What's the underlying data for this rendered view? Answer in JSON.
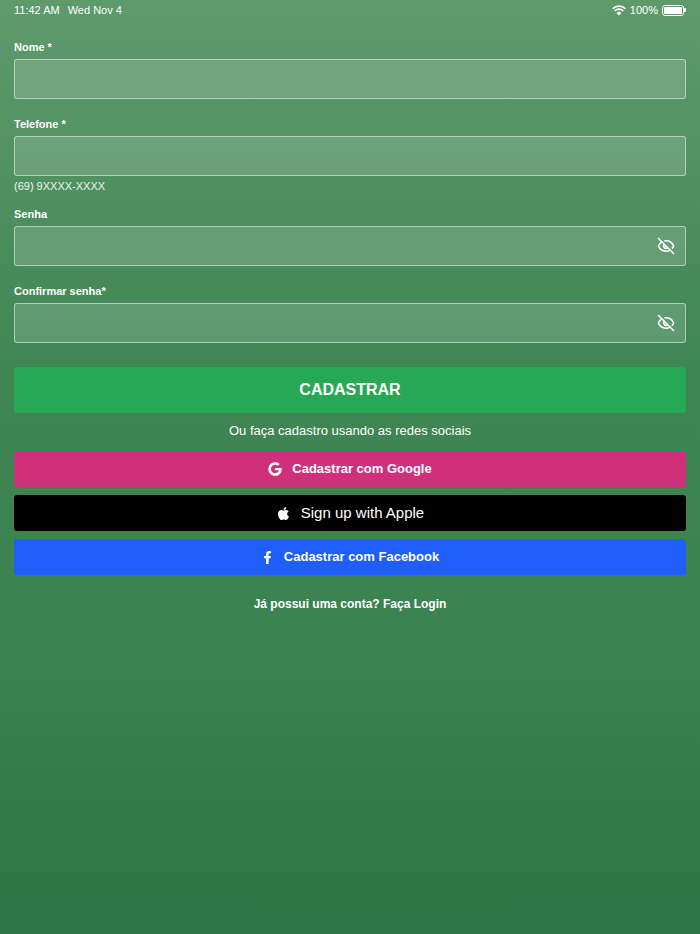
{
  "status_bar": {
    "time": "11:42 AM",
    "date": "Wed Nov 4",
    "battery": "100%",
    "battery_level": 1.0
  },
  "form": {
    "fields": [
      {
        "label": "Nome *",
        "kind": "text",
        "value": "",
        "hint": ""
      },
      {
        "label": "Telefone *",
        "kind": "text",
        "value": "",
        "hint": "(69) 9XXXX-XXXX"
      },
      {
        "label": "Senha",
        "kind": "password",
        "value": "",
        "hint": ""
      },
      {
        "label": "Confirmar senha*",
        "kind": "password",
        "value": "",
        "hint": ""
      }
    ],
    "submit": "CADASTRAR",
    "social_caption": "Ou faça cadastro usando as redes sociais",
    "social_buttons": [
      {
        "label": "Cadastrar com Google",
        "kind": "google",
        "color": "#d0307a"
      },
      {
        "label": "Sign up with Apple",
        "kind": "apple",
        "color": "#000000"
      },
      {
        "label": "Cadastrar com Facebook",
        "kind": "facebook",
        "color": "#1f5efb"
      }
    ],
    "login_link": "Já possui uma conta? Faça Login"
  }
}
